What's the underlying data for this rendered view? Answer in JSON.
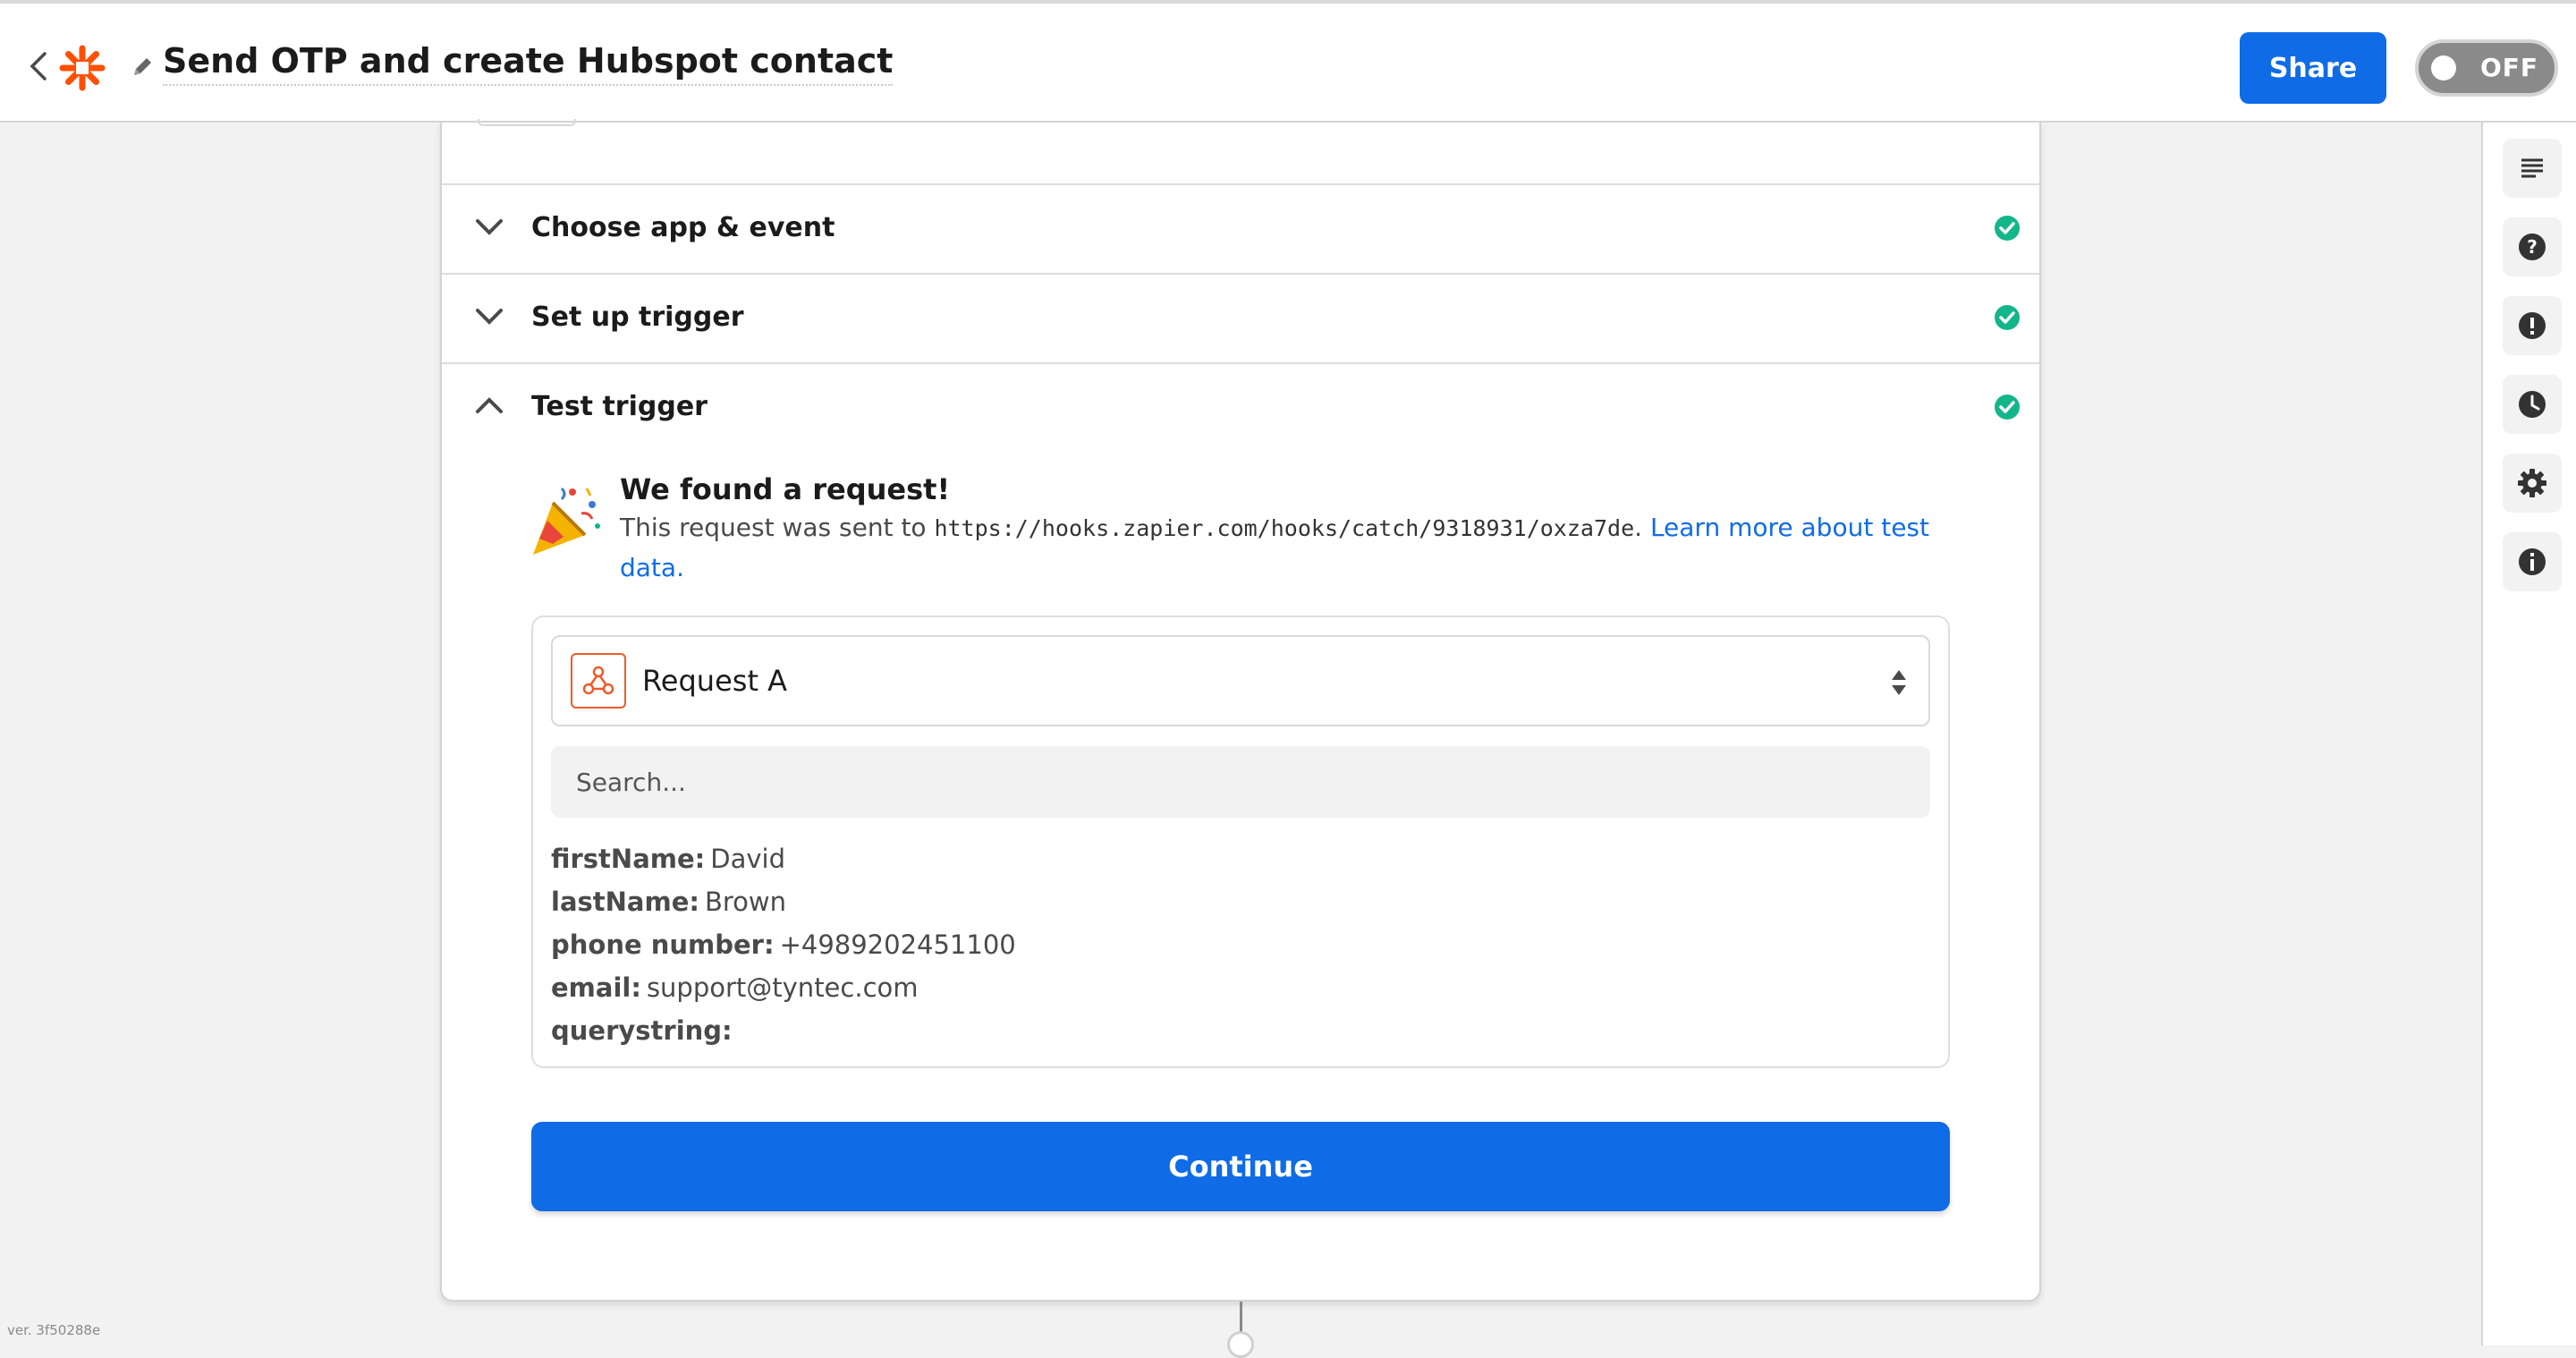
{
  "header": {
    "title": "Send OTP and create Hubspot contact",
    "share_label": "Share",
    "toggle_label": "OFF",
    "icons": [
      "back-chevron-icon",
      "zapier-logo-icon",
      "pencil-icon"
    ],
    "colors": {
      "brand": "#ff4f00",
      "primary": "#0f6ce6"
    }
  },
  "sections": [
    {
      "label": "Choose app & event",
      "state": "collapsed",
      "complete": true
    },
    {
      "label": "Set up trigger",
      "state": "collapsed",
      "complete": true
    },
    {
      "label": "Test trigger",
      "state": "expanded",
      "complete": true
    }
  ],
  "test": {
    "title": "We found a request!",
    "body_prefix": "This request was sent to ",
    "url": "https://hooks.zapier.com/hooks/catch/9318931/oxza7de",
    "body_suffix": ". ",
    "link_text": "Learn more about test data."
  },
  "request": {
    "selected": "Request A",
    "search_placeholder": "Search...",
    "fields": [
      {
        "key": "firstName:",
        "value": "David"
      },
      {
        "key": "lastName:",
        "value": "Brown"
      },
      {
        "key": "phone number:",
        "value": "+4989202451100"
      },
      {
        "key": "email:",
        "value": "support@tyntec.com"
      },
      {
        "key": "querystring:",
        "value": ""
      }
    ]
  },
  "continue_label": "Continue",
  "rail_icons": [
    "details-icon",
    "help-icon",
    "alert-icon",
    "history-icon",
    "settings-icon",
    "info-icon"
  ],
  "version": "ver. 3f50288e"
}
